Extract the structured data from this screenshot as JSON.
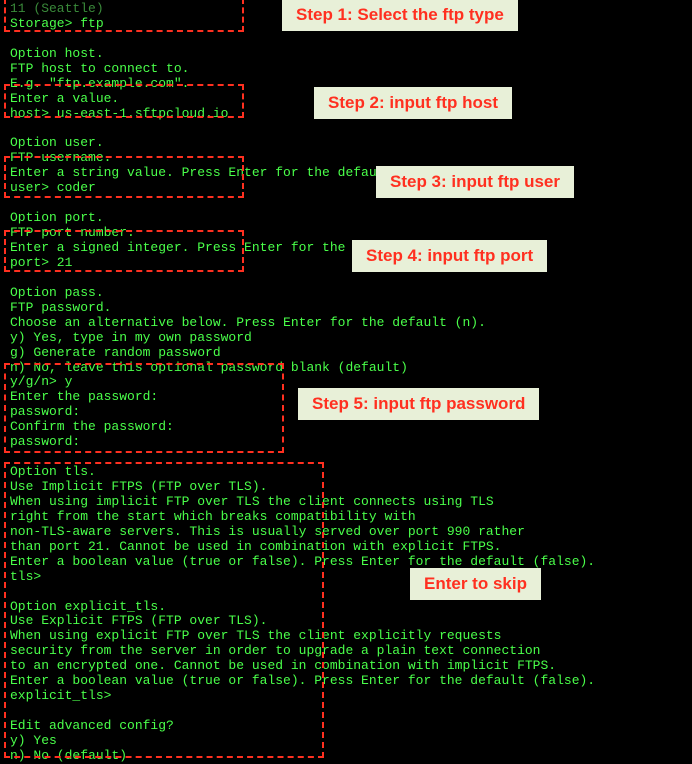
{
  "terminal": {
    "lines": [
      {
        "text": "11 (Seattle)",
        "faded": true
      },
      {
        "text": "Storage> ftp"
      },
      {
        "text": " "
      },
      {
        "text": "Option host."
      },
      {
        "text": "FTP host to connect to."
      },
      {
        "text": "E.g. \"ftp.example.com\"."
      },
      {
        "text": "Enter a value."
      },
      {
        "text": "host> us-east-1.sftpcloud.io"
      },
      {
        "text": " "
      },
      {
        "text": "Option user."
      },
      {
        "text": "FTP username."
      },
      {
        "text": "Enter a string value. Press Enter for the default (apple)."
      },
      {
        "text": "user> coder"
      },
      {
        "text": " "
      },
      {
        "text": "Option port."
      },
      {
        "text": "FTP port number."
      },
      {
        "text": "Enter a signed integer. Press Enter for the default (21)."
      },
      {
        "text": "port> 21"
      },
      {
        "text": " "
      },
      {
        "text": "Option pass."
      },
      {
        "text": "FTP password."
      },
      {
        "text": "Choose an alternative below. Press Enter for the default (n)."
      },
      {
        "text": "y) Yes, type in my own password"
      },
      {
        "text": "g) Generate random password"
      },
      {
        "text": "n) No, leave this optional password blank (default)"
      },
      {
        "text": "y/g/n> y"
      },
      {
        "text": "Enter the password:"
      },
      {
        "text": "password:"
      },
      {
        "text": "Confirm the password:"
      },
      {
        "text": "password:"
      },
      {
        "text": " "
      },
      {
        "text": "Option tls."
      },
      {
        "text": "Use Implicit FTPS (FTP over TLS)."
      },
      {
        "text": "When using implicit FTP over TLS the client connects using TLS"
      },
      {
        "text": "right from the start which breaks compatibility with"
      },
      {
        "text": "non-TLS-aware servers. This is usually served over port 990 rather"
      },
      {
        "text": "than port 21. Cannot be used in combination with explicit FTPS."
      },
      {
        "text": "Enter a boolean value (true or false). Press Enter for the default (false)."
      },
      {
        "text": "tls>"
      },
      {
        "text": " "
      },
      {
        "text": "Option explicit_tls."
      },
      {
        "text": "Use Explicit FTPS (FTP over TLS)."
      },
      {
        "text": "When using explicit FTP over TLS the client explicitly requests"
      },
      {
        "text": "security from the server in order to upgrade a plain text connection"
      },
      {
        "text": "to an encrypted one. Cannot be used in combination with implicit FTPS."
      },
      {
        "text": "Enter a boolean value (true or false). Press Enter for the default (false)."
      },
      {
        "text": "explicit_tls>"
      },
      {
        "text": " "
      },
      {
        "text": "Edit advanced config?"
      },
      {
        "text": "y) Yes"
      },
      {
        "text": "n) No (default)"
      }
    ]
  },
  "annotations": {
    "step1": "Step 1: Select the ftp type",
    "step2": "Step 2:  input ftp host",
    "step3": "Step 3:  input ftp user",
    "step4": "Step 4:  input ftp port",
    "step5": "Step 5:  input ftp password",
    "enter_skip": "Enter to skip"
  }
}
